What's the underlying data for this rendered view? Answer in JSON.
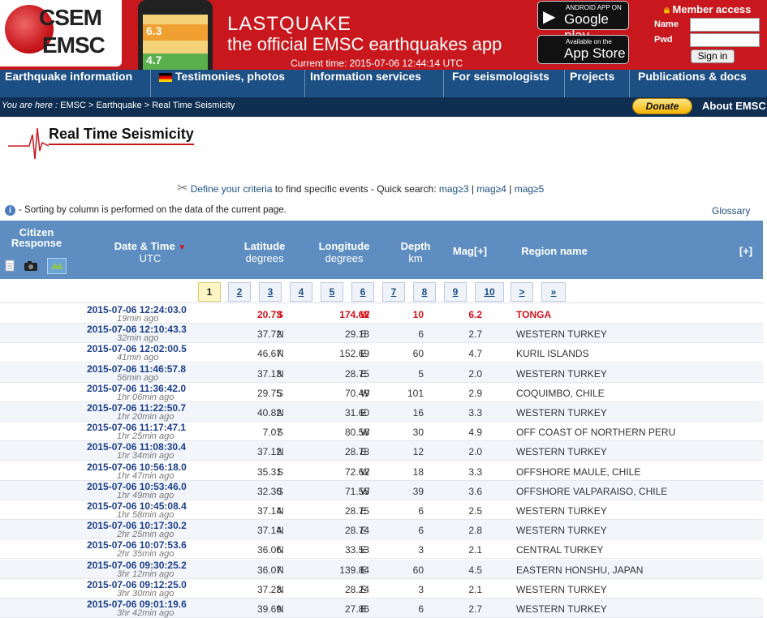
{
  "header": {
    "logo_line1": "CSEM",
    "logo_line2": "EMSC",
    "app_title": "LASTQUAKE",
    "app_subtitle": "the official EMSC earthquakes app",
    "current_time": "Current time: 2015-07-06 12:44:14 UTC",
    "phone_value1": "6.3",
    "phone_value2": "4.7",
    "google_play_small": "ANDROID APP ON",
    "google_play_big": "Google play",
    "app_store_small": "Available on the",
    "app_store_big": "App Store",
    "member_access": "Member access",
    "name_label": "Name",
    "pwd_label": "Pwd",
    "signin_label": "Sign in"
  },
  "nav": {
    "items": [
      "Earthquake information",
      "Testimonies, photos",
      "Information services",
      "For seismologists",
      "Projects",
      "Publications & docs"
    ]
  },
  "breadcrumb": {
    "prefix": "You are here :",
    "path": "EMSC > Earthquake > Real Time Seismicity",
    "donate": "Donate",
    "about": "About EMSC"
  },
  "page": {
    "title": "Real Time Seismicity",
    "criteria_link": "Define your criteria",
    "criteria_text": " to find specific events - Quick search: ",
    "quick": [
      "mag≥3",
      "mag≥4",
      "mag≥5"
    ],
    "sorting_note": "- Sorting by column is performed on the data of the current page.",
    "glossary": "Glossary"
  },
  "table": {
    "headers": {
      "citizen": "Citizen Response",
      "datetime": "Date & Time",
      "datetime_unit": "UTC",
      "latitude": "Latitude",
      "latitude_unit": "degrees",
      "longitude": "Longitude",
      "longitude_unit": "degrees",
      "depth": "Depth",
      "depth_unit": "km",
      "mag": "Mag[+]",
      "region": "Region name",
      "expand": "[+]"
    },
    "pages": [
      "1",
      "2",
      "3",
      "4",
      "5",
      "6",
      "7",
      "8",
      "9",
      "10",
      ">",
      "»"
    ],
    "rows": [
      {
        "dt": "2015-07-06   12:24:03.0",
        "ago": "19min ago",
        "lat": "20.73",
        "lath": "S",
        "lon": "174.62",
        "lonh": "W",
        "depth": "10",
        "mag": "6.2",
        "region": "TONGA"
      },
      {
        "dt": "2015-07-06   12:10:43.3",
        "ago": "32min ago",
        "lat": "37.72",
        "lath": "N",
        "lon": "29.18",
        "lonh": "E",
        "depth": "6",
        "mag": "2.7",
        "region": "WESTERN TURKEY"
      },
      {
        "dt": "2015-07-06   12:02:00.5",
        "ago": "41min ago",
        "lat": "46.67",
        "lath": "N",
        "lon": "152.69",
        "lonh": "E",
        "depth": "60",
        "mag": "4.7",
        "region": "KURIL ISLANDS"
      },
      {
        "dt": "2015-07-06   11:46:57.8",
        "ago": "56min ago",
        "lat": "37.13",
        "lath": "N",
        "lon": "28.75",
        "lonh": "E",
        "depth": "5",
        "mag": "2.0",
        "region": "WESTERN TURKEY"
      },
      {
        "dt": "2015-07-06   11:36:42.0",
        "ago": "1hr 06min ago",
        "lat": "29.75",
        "lath": "S",
        "lon": "70.49",
        "lonh": "W",
        "depth": "101",
        "mag": "2.9",
        "region": "COQUIMBO, CHILE"
      },
      {
        "dt": "2015-07-06   11:22:50.7",
        "ago": "1hr 20min ago",
        "lat": "40.82",
        "lath": "N",
        "lon": "31.60",
        "lonh": "E",
        "depth": "16",
        "mag": "3.3",
        "region": "WESTERN TURKEY"
      },
      {
        "dt": "2015-07-06   11:17:47.1",
        "ago": "1hr 25min ago",
        "lat": "7.07",
        "lath": "S",
        "lon": "80.58",
        "lonh": "W",
        "depth": "30",
        "mag": "4.9",
        "region": "OFF COAST OF NORTHERN PERU"
      },
      {
        "dt": "2015-07-06   11:08:30.4",
        "ago": "1hr 34min ago",
        "lat": "37.12",
        "lath": "N",
        "lon": "28.78",
        "lonh": "E",
        "depth": "12",
        "mag": "2.0",
        "region": "WESTERN TURKEY"
      },
      {
        "dt": "2015-07-06   10:56:18.0",
        "ago": "1hr 47min ago",
        "lat": "35.31",
        "lath": "S",
        "lon": "72.62",
        "lonh": "W",
        "depth": "18",
        "mag": "3.3",
        "region": "OFFSHORE MAULE, CHILE"
      },
      {
        "dt": "2015-07-06   10:53:46.0",
        "ago": "1hr 49min ago",
        "lat": "32.30",
        "lath": "S",
        "lon": "71.55",
        "lonh": "W",
        "depth": "39",
        "mag": "3.6",
        "region": "OFFSHORE VALPARAISO, CHILE"
      },
      {
        "dt": "2015-07-06   10:45:08.4",
        "ago": "1hr 58min ago",
        "lat": "37.14",
        "lath": "N",
        "lon": "28.75",
        "lonh": "E",
        "depth": "6",
        "mag": "2.5",
        "region": "WESTERN TURKEY"
      },
      {
        "dt": "2015-07-06   10:17:30.2",
        "ago": "2hr 25min ago",
        "lat": "37.14",
        "lath": "N",
        "lon": "28.74",
        "lonh": "E",
        "depth": "6",
        "mag": "2.8",
        "region": "WESTERN TURKEY"
      },
      {
        "dt": "2015-07-06   10:07:53.6",
        "ago": "2hr 35min ago",
        "lat": "36.06",
        "lath": "N",
        "lon": "33.53",
        "lonh": "E",
        "depth": "3",
        "mag": "2.1",
        "region": "CENTRAL TURKEY"
      },
      {
        "dt": "2015-07-06   09:30:25.2",
        "ago": "3hr 12min ago",
        "lat": "36.07",
        "lath": "N",
        "lon": "139.84",
        "lonh": "E",
        "depth": "60",
        "mag": "4.5",
        "region": "EASTERN HONSHU, JAPAN"
      },
      {
        "dt": "2015-07-06   09:12:25.0",
        "ago": "3hr 30min ago",
        "lat": "37.23",
        "lath": "N",
        "lon": "28.24",
        "lonh": "E",
        "depth": "3",
        "mag": "2.1",
        "region": "WESTERN TURKEY"
      },
      {
        "dt": "2015-07-06   09:01:19.6",
        "ago": "3hr 42min ago",
        "lat": "39.69",
        "lath": "N",
        "lon": "27.86",
        "lonh": "E",
        "depth": "6",
        "mag": "2.7",
        "region": "WESTERN TURKEY"
      }
    ]
  },
  "colors": {
    "header_red": "#c8181e",
    "nav_blue": "#1c4f84",
    "table_header": "#5e8ec1",
    "highlight": "#d2141b"
  }
}
